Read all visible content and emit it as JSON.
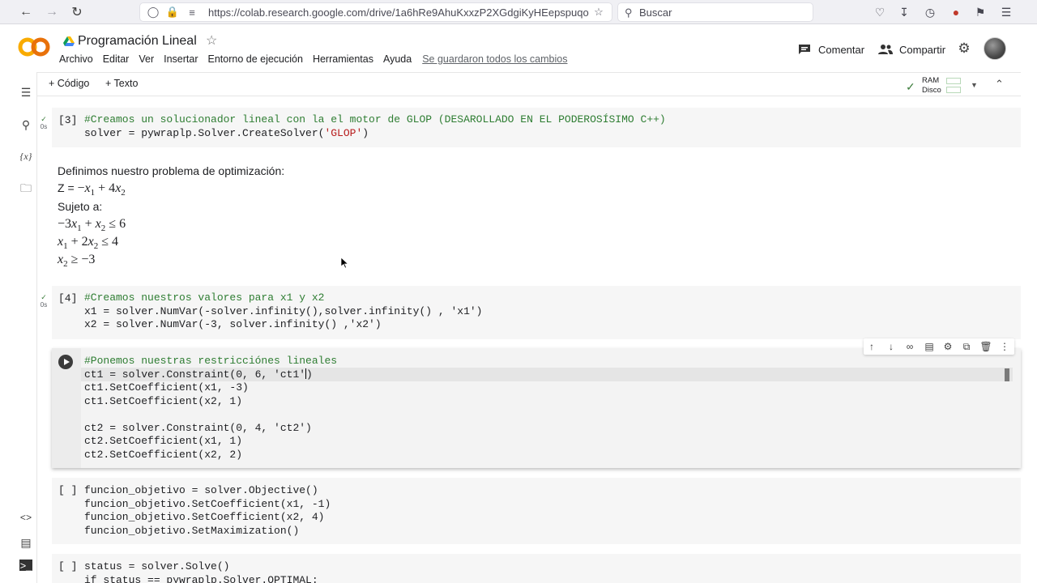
{
  "browser": {
    "url": "https://colab.research.google.com/drive/1a6hRe9AhuKxxzP2XGdgiKyHEepspuqof#sc",
    "search_placeholder": "Buscar"
  },
  "header": {
    "logo_text": "CO",
    "title": "Programación Lineal",
    "menu": [
      "Archivo",
      "Editar",
      "Ver",
      "Insertar",
      "Entorno de ejecución",
      "Herramientas",
      "Ayuda"
    ],
    "saved_status": "Se guardaron todos los cambios",
    "comment_label": "Comentar",
    "share_label": "Compartir"
  },
  "toolbar": {
    "add_code": "+ Código",
    "add_text": "+ Texto",
    "ram_label": "RAM",
    "disk_label": "Disco"
  },
  "cells": {
    "c3": {
      "exec": "[3]",
      "time": "0s",
      "comment": "#Creamos un solucionador lineal con la el motor de GLOP (DESAROLLADO EN EL PODEROSÍSIMO C++)",
      "line2_pre": "solver = pywraplp.Solver.CreateSolver(",
      "line2_str": "'GLOP'",
      "line2_post": ")"
    },
    "text": {
      "intro": "Definimos nuestro problema de optimización:",
      "subject": "Sujeto a:"
    },
    "c4": {
      "exec": "[4]",
      "time": "0s",
      "comment": "#Creamos nuestros valores para x1 y x2",
      "line2": "x1 = solver.NumVar(-solver.infinity(),solver.infinity() , 'x1')",
      "line3": "x2 = solver.NumVar(-3, solver.infinity() ,'x2')"
    },
    "active": {
      "comment": "#Ponemos nuestras restricciónes lineales",
      "l2_pre": "ct1 = solver.Constraint(0, 6, 'ct1'",
      "l2_post": ")",
      "l3": "ct1.SetCoefficient(x1, -3)",
      "l4": "ct1.SetCoefficient(x2, 1)",
      "l5": "ct2 = solver.Constraint(0, 4, 'ct2')",
      "l6": "ct2.SetCoefficient(x1, 1)",
      "l7": "ct2.SetCoefficient(x2, 2)"
    },
    "c5": {
      "exec": "[ ]",
      "l1": "funcion_objetivo = solver.Objective()",
      "l2": "funcion_objetivo.SetCoefficient(x1, -1)",
      "l3": "funcion_objetivo.SetCoefficient(x2, 4)",
      "l4": "funcion_objetivo.SetMaximization()"
    },
    "c6": {
      "exec": "[ ]",
      "l1": "status = solver.Solve()",
      "l2": "if status == pywraplp.Solver.OPTIMAL:"
    }
  }
}
